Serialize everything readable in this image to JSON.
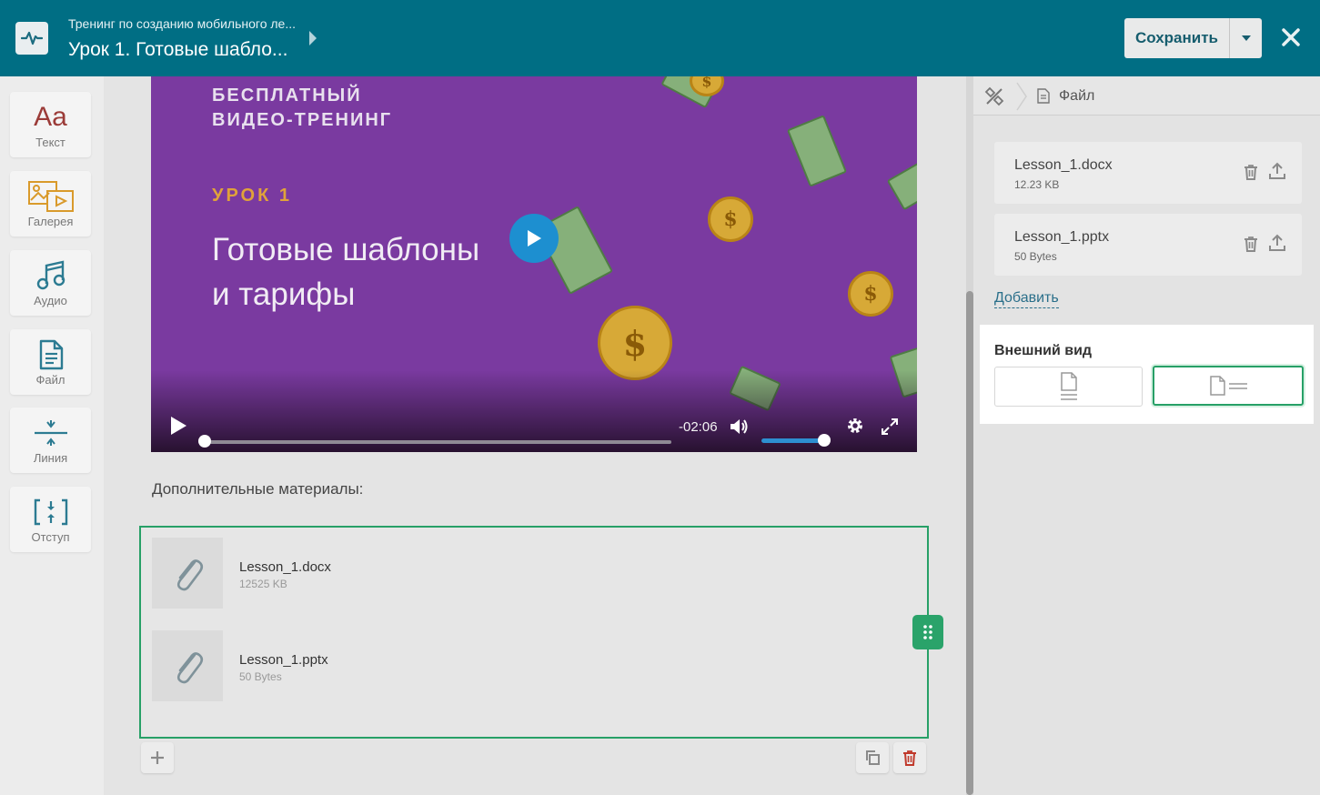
{
  "header": {
    "course_title": "Тренинг по созданию мобильного ле...",
    "lesson_title": "Урок 1. Готовые шабло...",
    "save_label": "Сохранить"
  },
  "toolbar": {
    "items": [
      {
        "label": "Текст",
        "icon": "text-icon"
      },
      {
        "label": "Галерея",
        "icon": "gallery-icon"
      },
      {
        "label": "Аудио",
        "icon": "music-note-icon"
      },
      {
        "label": "Файл",
        "icon": "file-icon"
      },
      {
        "label": "Линия",
        "icon": "line-icon"
      },
      {
        "label": "Отступ",
        "icon": "spacing-icon"
      }
    ],
    "text_glyph": "Aa"
  },
  "video": {
    "caption_line1": "БЕСПЛАТНЫЙ",
    "caption_line2": "ВИДЕО-ТРЕНИНГ",
    "lesson_tag": "УРОК 1",
    "heading_line1": "Готовые шаблоны",
    "heading_line2": "и тарифы",
    "time_remaining": "-02:06",
    "volume": 0.9,
    "progress": 0.0,
    "coin_symbol": "$"
  },
  "content": {
    "materials_label": "Дополнительные материалы:",
    "files": [
      {
        "name": "Lesson_1.docx",
        "size": "12525 KB"
      },
      {
        "name": "Lesson_1.pptx",
        "size": "50 Bytes"
      }
    ]
  },
  "panel": {
    "breadcrumb_label": "Файл",
    "files": [
      {
        "name": "Lesson_1.docx",
        "size": "12.23 KB"
      },
      {
        "name": "Lesson_1.pptx",
        "size": "50 Bytes"
      }
    ],
    "add_label": "Добавить",
    "appearance_title": "Внешний вид",
    "selected_appearance": "inline"
  },
  "colors": {
    "header_bg": "#006e84",
    "accent_green": "#27a067",
    "link": "#2a6f8a",
    "video_bg": "#7a3aa0",
    "delete_red": "#c0392b"
  }
}
